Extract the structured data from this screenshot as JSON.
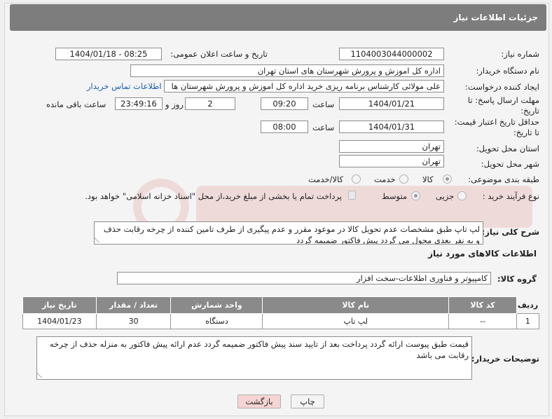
{
  "header": {
    "title": "جزئیات اطلاعات نیاز"
  },
  "fields": {
    "need_number": {
      "label": "شماره نیاز:",
      "value": "1104003044000002"
    },
    "announce_datetime": {
      "label": "تاریخ و ساعت اعلان عمومی:",
      "value": "1404/01/18 - 08:25"
    },
    "buyer_org": {
      "label": "نام دستگاه خریدار:",
      "value": "اداره کل اموزش و پرورش شهرستان های استان تهران"
    },
    "requester": {
      "label": "ایجاد کننده درخواست:",
      "value": "علی مولائی کارشناس برنامه ریزی خرید  اداره کل اموزش و پرورش شهرستان ها",
      "contact_link": "اطلاعات تماس خریدار"
    },
    "reply_deadline": {
      "label_line1": "مهلت ارسال پاسخ: تا",
      "label_line2": "تاریخ:",
      "date": "1404/01/21",
      "time_label": "ساعت",
      "time": "09:20",
      "days": "2",
      "days_label": "روز و",
      "remaining": "23:49:16",
      "remaining_label": "ساعت باقی مانده"
    },
    "price_validity": {
      "label_line1": "حداقل تاریخ اعتبار قیمت:",
      "label_line2": "تا تاریخ:",
      "date": "1404/01/31",
      "time_label": "ساعت",
      "time": "08:00"
    },
    "delivery_province": {
      "label": "استان محل تحویل:",
      "value": "تهران"
    },
    "delivery_city": {
      "label": "شهر محل تحویل:",
      "value": "تهران"
    },
    "category": {
      "label": "طبقه بندی موضوعی:",
      "options": [
        "کالا",
        "خدمت",
        "کالا/خدمت"
      ],
      "selected": "کالا"
    },
    "purchase_process": {
      "label": "نوع فرآیند خرید :",
      "options": [
        "جزیی",
        "متوسط"
      ],
      "selected": "متوسط",
      "payment_note": "پرداخت تمام یا بخشی از مبلغ خرید،از محل \"اسناد خزانه اسلامی\" خواهد بود."
    }
  },
  "description": {
    "label": "شرح کلی نیاز:",
    "text": "لپ تاپ طبق مشخصات  عدم تحویل کالا در موعود مقرر و عدم پیگیری از طرف تامین کننده از چرخه رقابت حذف و به نفر بعدی محول می گردد پیش فاکتور ضمیمه گردد"
  },
  "goods_section": {
    "title": "اطلاعات کالاهای مورد نیاز",
    "group_label": "گروه کالا:",
    "group_value": "کامپیوتر و فناوری اطلاعات-سخت افزار"
  },
  "table": {
    "headers": [
      "ردیف",
      "کد کالا",
      "نام کالا",
      "واحد شمارش",
      "تعداد / مقدار",
      "تاریخ نیاز"
    ],
    "rows": [
      [
        "1",
        "--",
        "لپ تاپ",
        "دستگاه",
        "30",
        "1404/01/23"
      ]
    ]
  },
  "buyer_notes": {
    "label": "توضیحات خریدار:",
    "text": "قیمت طبق پیوست  ارائه گردد پرداخت بعد از تایید سند پیش فاکتور ضمیمه گردد عدم ارائه پیش فاکتور به منزله حذف از چرخه رقابت می باشد"
  },
  "buttons": {
    "print": "چاپ",
    "back": "بازگشت"
  },
  "colors": {
    "header_bg": "#7d7d7d",
    "link": "#1a5fb4",
    "back_btn_bg": "#f6d4d4"
  },
  "icons": {
    "watermark": "ariatender-logo"
  }
}
